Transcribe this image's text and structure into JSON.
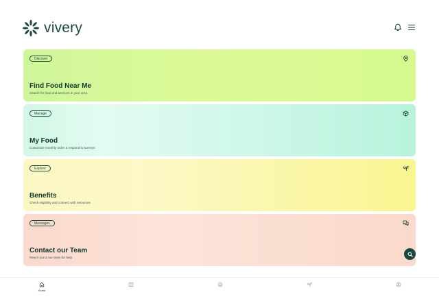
{
  "app": {
    "logo_text": "vivery",
    "icons": {
      "logo": "sparkle-logo-icon",
      "notifications": "bell-icon",
      "menu": "hamburger-menu-icon"
    }
  },
  "cards": [
    {
      "tag": "Discover",
      "title": "Find Food Near Me",
      "subtitle": "Search for food and services in your area",
      "icon": "location-pin-icon",
      "color": "#d6fa8d"
    },
    {
      "tag": "Manage",
      "title": "My Food",
      "subtitle": "Customize monthly order & respond to surveys",
      "icon": "box-icon",
      "color": "#b7f3dc"
    },
    {
      "tag": "Explore",
      "title": "Benefits",
      "subtitle": "Check eligibility and connect with resources",
      "icon": "sprout-icon",
      "color": "#f9f590"
    },
    {
      "tag": "Messages",
      "title": "Contact our Team",
      "subtitle": "Reach out to our team for help",
      "icon": "chat-bubbles-icon",
      "color": "#f9d9cb"
    }
  ],
  "fab": {
    "icon": "search-icon",
    "color": "#17493d"
  },
  "bottom_nav": [
    {
      "label": "Home",
      "icon": "home-icon",
      "active": true
    },
    {
      "label": "",
      "icon": "map-icon",
      "active": false
    },
    {
      "label": "",
      "icon": "box-icon",
      "active": false
    },
    {
      "label": "",
      "icon": "sprout-icon",
      "active": false
    },
    {
      "label": "",
      "icon": "account-icon",
      "active": false
    }
  ],
  "colors": {
    "brand": "#1c4a3d",
    "text": "#12372e"
  }
}
